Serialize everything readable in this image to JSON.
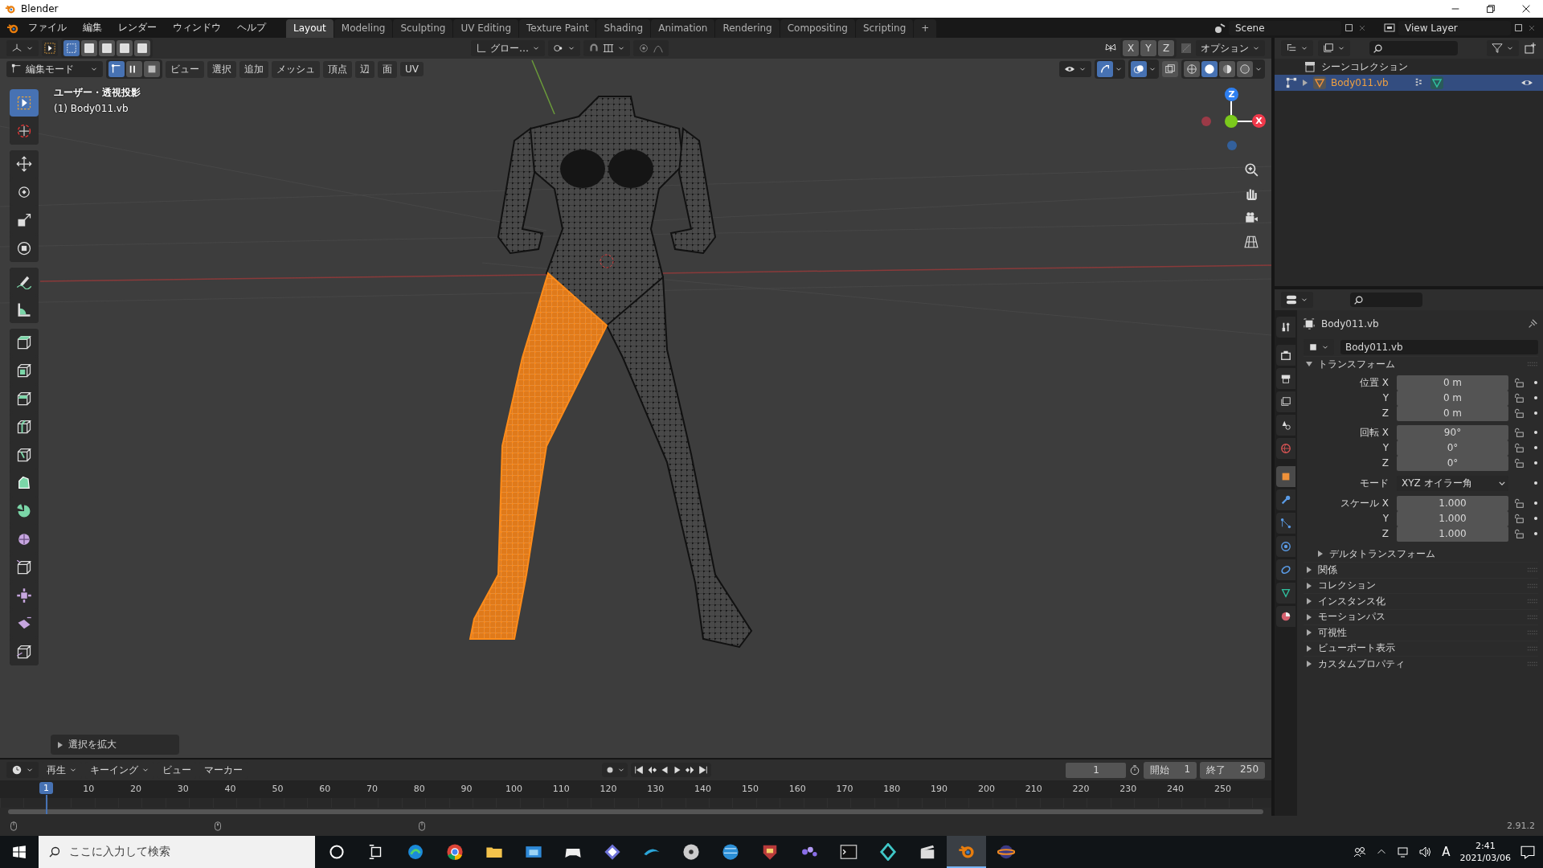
{
  "window": {
    "title": "Blender"
  },
  "menu": [
    "ファイル",
    "編集",
    "レンダー",
    "ウィンドウ",
    "ヘルプ"
  ],
  "workspaces": [
    {
      "label": "Layout",
      "selected": true
    },
    {
      "label": "Modeling",
      "selected": false
    },
    {
      "label": "Sculpting",
      "selected": false
    },
    {
      "label": "UV Editing",
      "selected": false
    },
    {
      "label": "Texture Paint",
      "selected": false
    },
    {
      "label": "Shading",
      "selected": false
    },
    {
      "label": "Animation",
      "selected": false
    },
    {
      "label": "Rendering",
      "selected": false
    },
    {
      "label": "Compositing",
      "selected": false
    },
    {
      "label": "Scripting",
      "selected": false
    }
  ],
  "add_workspace": "+",
  "scene": "Scene",
  "view_layer": "View Layer",
  "viewport": {
    "transform_orientation": "グロー…",
    "mirror_axes": [
      "X",
      "Y",
      "Z"
    ],
    "options": "オプション",
    "mode": "編集モード",
    "select_modes": [
      {
        "selected": true
      },
      {
        "selected": false
      },
      {
        "selected": false
      }
    ],
    "menus": [
      "ビュー",
      "選択",
      "追加",
      "メッシュ",
      "頂点",
      "辺",
      "面",
      "UV"
    ],
    "gizmo_toggle": {
      "on": true
    },
    "overlay_toggle": {
      "on": true
    },
    "shading": [
      {
        "selected": false
      },
      {
        "selected": true
      },
      {
        "selected": false
      },
      {
        "selected": false
      }
    ],
    "view_name": "ユーザー・透視投影",
    "object_label": "(1) Body011.vb",
    "gizmo_axes": [
      "Z",
      "X"
    ],
    "last_operator": "選択を拡大",
    "tool_groups": [
      {
        "tools": [
          {
            "kind": "select",
            "selected": true
          },
          {
            "kind": "cursor",
            "selected": false
          }
        ]
      },
      {
        "tools": [
          {
            "kind": "move",
            "selected": false
          },
          {
            "kind": "rotate",
            "selected": false
          },
          {
            "kind": "scale",
            "selected": false
          },
          {
            "kind": "transform",
            "selected": false
          }
        ]
      },
      {
        "tools": [
          {
            "kind": "annotate",
            "selected": false
          },
          {
            "kind": "measure",
            "selected": false
          }
        ]
      },
      {
        "tools": [
          {
            "kind": "extrude",
            "selected": false
          },
          {
            "kind": "inset",
            "selected": false
          },
          {
            "kind": "bevel",
            "selected": false
          },
          {
            "kind": "loopcut",
            "selected": false
          },
          {
            "kind": "knife",
            "selected": false
          },
          {
            "kind": "polybuild",
            "selected": false
          },
          {
            "kind": "spin",
            "selected": false
          },
          {
            "kind": "smooth",
            "selected": false
          },
          {
            "kind": "slide",
            "selected": false
          },
          {
            "kind": "shrink",
            "selected": false
          },
          {
            "kind": "shear",
            "selected": false
          },
          {
            "kind": "rip",
            "selected": false
          }
        ]
      }
    ]
  },
  "outliner": {
    "tree": [
      {
        "label": "シーンコレクション",
        "selected": false,
        "children": [
          {
            "label": "Body011.vb",
            "selected": true,
            "expanded": false
          }
        ]
      }
    ]
  },
  "properties": {
    "tabs": [
      {
        "kind": "tool",
        "selected": false
      },
      {
        "kind": "render",
        "selected": false
      },
      {
        "kind": "output",
        "selected": false
      },
      {
        "kind": "view_layer",
        "selected": false
      },
      {
        "kind": "scene",
        "selected": false
      },
      {
        "kind": "world",
        "selected": false
      },
      {
        "kind": "object",
        "selected": true
      },
      {
        "kind": "modifiers",
        "selected": false
      },
      {
        "kind": "particles",
        "selected": false
      },
      {
        "kind": "physics",
        "selected": false
      },
      {
        "kind": "constraints",
        "selected": false
      },
      {
        "kind": "data",
        "selected": false
      },
      {
        "kind": "material",
        "selected": false
      }
    ],
    "object_name": "Body011.vb",
    "datablock": "Body011.vb",
    "transform": {
      "title": "トランスフォーム",
      "expanded": true,
      "groups": [
        {
          "rows": [
            {
              "kind": "number",
              "label": "位置 X",
              "value": "0 m"
            },
            {
              "kind": "number",
              "label": "Y",
              "value": "0 m"
            },
            {
              "kind": "number",
              "label": "Z",
              "value": "0 m"
            }
          ]
        },
        {
          "rows": [
            {
              "kind": "number",
              "label": "回転 X",
              "value": "90°"
            },
            {
              "kind": "number",
              "label": "Y",
              "value": "0°"
            },
            {
              "kind": "number",
              "label": "Z",
              "value": "0°"
            }
          ]
        },
        {
          "rows": [
            {
              "kind": "dropdown",
              "label": "モード",
              "value": "XYZ オイラー角"
            }
          ]
        },
        {
          "rows": [
            {
              "kind": "number",
              "label": "スケール X",
              "value": "1.000"
            },
            {
              "kind": "number",
              "label": "Y",
              "value": "1.000"
            },
            {
              "kind": "number",
              "label": "Z",
              "value": "1.000"
            }
          ]
        }
      ],
      "subpanel": {
        "title": "デルタトランスフォーム",
        "expanded": false
      }
    },
    "panels": [
      {
        "title": "関係",
        "expanded": false
      },
      {
        "title": "コレクション",
        "expanded": false
      },
      {
        "title": "インスタンス化",
        "expanded": false
      },
      {
        "title": "モーションパス",
        "expanded": false
      },
      {
        "title": "可視性",
        "expanded": false
      },
      {
        "title": "ビューポート表示",
        "expanded": false
      },
      {
        "title": "カスタムプロパティ",
        "expanded": false
      }
    ]
  },
  "timeline": {
    "menus": [
      "再生",
      "キーイング",
      "ビュー",
      "マーカー"
    ],
    "current_frame": "1",
    "start_label": "開始",
    "start": "1",
    "end_label": "終了",
    "end": "250",
    "playhead": "1",
    "ticks": [
      "10",
      "20",
      "30",
      "40",
      "50",
      "60",
      "70",
      "80",
      "90",
      "100",
      "110",
      "120",
      "130",
      "140",
      "150",
      "160",
      "170",
      "180",
      "190",
      "200",
      "210",
      "220",
      "230",
      "240",
      "250"
    ]
  },
  "status_bar": {
    "version": "2.91.2"
  },
  "taskbar": {
    "search_placeholder": "ここに入力して検索",
    "apps": [
      {
        "kind": "cortana",
        "selected": false
      },
      {
        "kind": "taskview",
        "selected": false
      },
      {
        "kind": "edge",
        "selected": false
      },
      {
        "kind": "chrome",
        "selected": false
      },
      {
        "kind": "explorer",
        "selected": false
      },
      {
        "kind": "store",
        "selected": false
      },
      {
        "kind": "gamepad",
        "selected": false
      },
      {
        "kind": "diamond",
        "selected": false
      },
      {
        "kind": "swoosh",
        "selected": false
      },
      {
        "kind": "disc",
        "selected": false
      },
      {
        "kind": "globe",
        "selected": false
      },
      {
        "kind": "shield",
        "selected": false
      },
      {
        "kind": "dots",
        "selected": false
      },
      {
        "kind": "terminal",
        "selected": false
      },
      {
        "kind": "crystal",
        "selected": false
      },
      {
        "kind": "clapper",
        "selected": false
      },
      {
        "kind": "blender",
        "selected": true
      },
      {
        "kind": "planet",
        "selected": false
      }
    ],
    "ime": "A",
    "time": "2:41",
    "date": "2021/03/06"
  }
}
